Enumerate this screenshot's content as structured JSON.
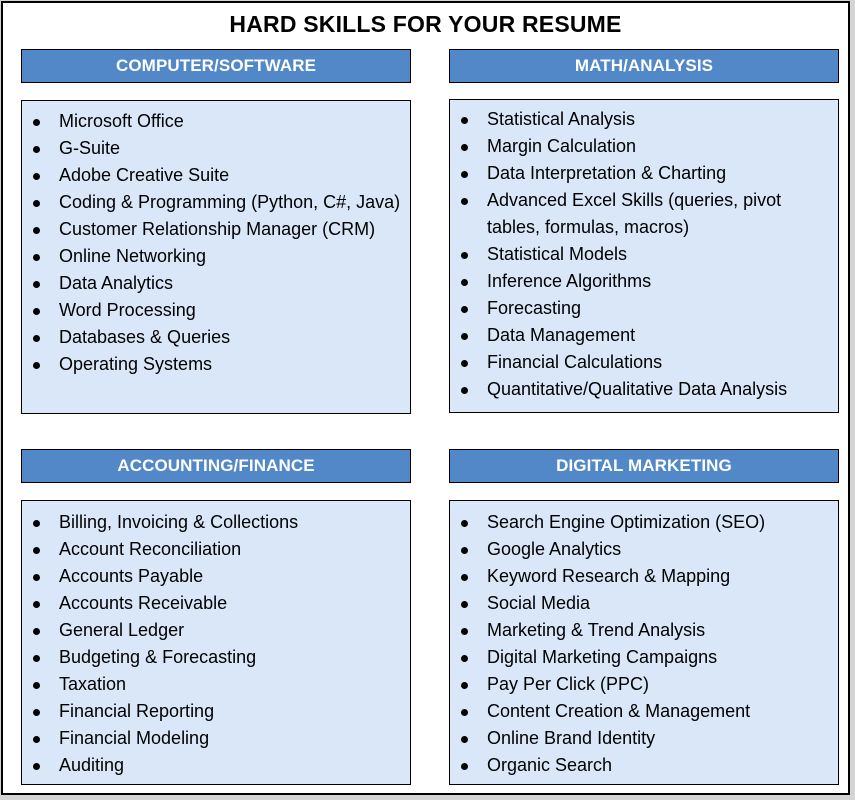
{
  "title": "HARD SKILLS FOR YOUR RESUME",
  "colors": {
    "header_bg": "#5288c8",
    "box_bg": "#dae7f8",
    "header_text": "#ffffff"
  },
  "sections": [
    {
      "id": "computer_software",
      "header": "COMPUTER/SOFTWARE",
      "items": [
        "Microsoft Office",
        "G-Suite",
        "Adobe Creative Suite",
        "Coding & Programming (Python, C#, Java)",
        "Customer Relationship Manager (CRM)",
        "Online Networking",
        "Data Analytics",
        "Word Processing",
        "Databases & Queries",
        "Operating Systems"
      ]
    },
    {
      "id": "math_analysis",
      "header": "MATH/ANALYSIS",
      "items": [
        "Statistical Analysis",
        "Margin Calculation",
        "Data Interpretation & Charting",
        "Advanced Excel Skills (queries, pivot tables, formulas, macros)",
        "Statistical Models",
        "Inference Algorithms",
        "Forecasting",
        "Data Management",
        "Financial Calculations",
        "Quantitative/Qualitative Data Analysis"
      ]
    },
    {
      "id": "accounting_finance",
      "header": "ACCOUNTING/FINANCE",
      "items": [
        "Billing, Invoicing & Collections",
        "Account Reconciliation",
        "Accounts Payable",
        "Accounts Receivable",
        "General Ledger",
        "Budgeting & Forecasting",
        "Taxation",
        "Financial Reporting",
        "Financial Modeling",
        "Auditing"
      ]
    },
    {
      "id": "digital_marketing",
      "header": "DIGITAL MARKETING",
      "items": [
        "Search Engine Optimization (SEO)",
        "Google Analytics",
        "Keyword Research & Mapping",
        "Social Media",
        "Marketing & Trend Analysis",
        "Digital Marketing Campaigns",
        "Pay Per Click (PPC)",
        "Content Creation & Management",
        "Online Brand Identity",
        "Organic Search"
      ]
    }
  ]
}
